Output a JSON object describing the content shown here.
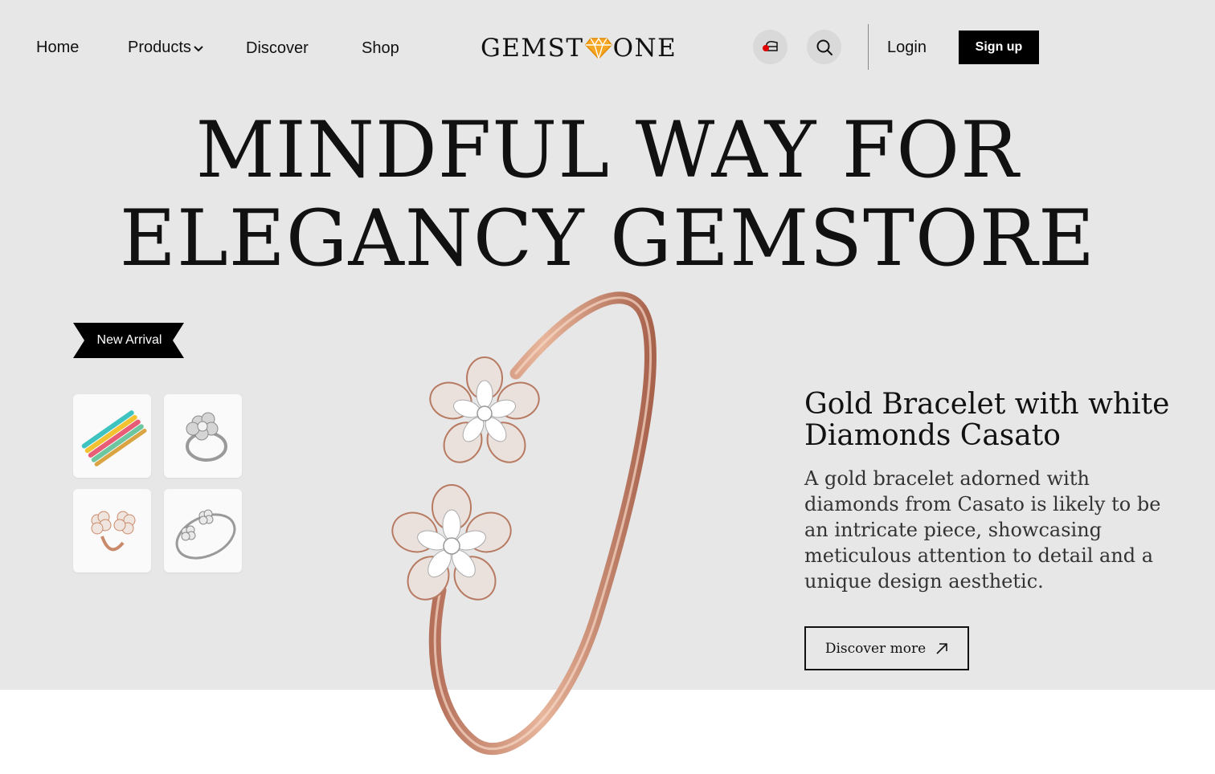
{
  "nav": {
    "home": "Home",
    "products": "Products",
    "discover": "Discover",
    "shop": "Shop"
  },
  "logo": {
    "left": "GEMST",
    "right": "ONE",
    "gem_color": "#f5a623"
  },
  "header": {
    "cart_icon": "cart-icon",
    "search_icon": "search-icon",
    "cart_badge_color": "#e30000",
    "login": "Login",
    "signup": "Sign up"
  },
  "hero": {
    "line1": "MINDFUL WAY FOR",
    "line2": "ELEGANCY GEMSTORE",
    "tag": "New Arrival"
  },
  "thumbnails": [
    {
      "name": "multicolor-bracelet-stack"
    },
    {
      "name": "silver-flower-ring"
    },
    {
      "name": "rose-gold-flower-ring"
    },
    {
      "name": "silver-flower-bangle"
    }
  ],
  "product": {
    "title": "Gold Bracelet with white\nDiamonds  Casato",
    "description": "A gold bracelet adorned with diamonds from Casato is likely to be an intricate piece, showcasing meticulous attention to detail and a unique design aesthetic.",
    "cta": "Discover more",
    "cta_icon": "arrow-up-right-icon"
  },
  "colors": {
    "hero_bg": "#e7e7e7",
    "metal": "#c98a6b",
    "black": "#000000"
  }
}
